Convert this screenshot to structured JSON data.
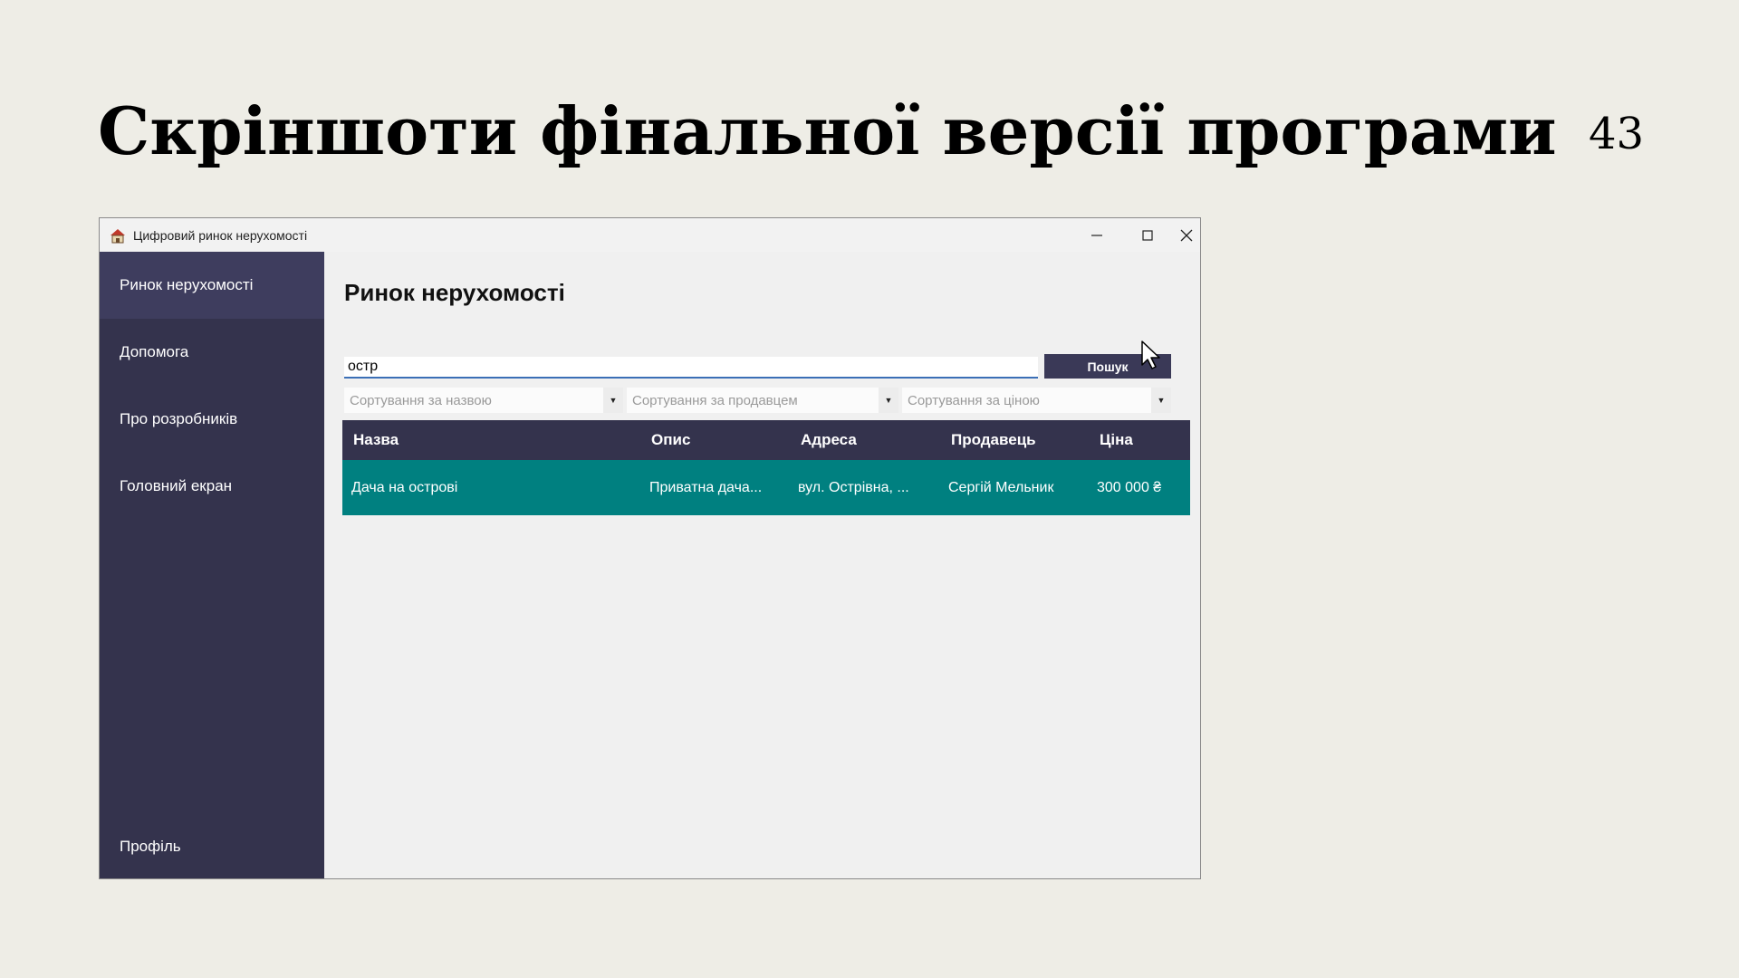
{
  "slide": {
    "title": "Скріншоти фінальної версії програми",
    "page_number": "43"
  },
  "window": {
    "title": "Цифровий ринок нерухомості",
    "icons": [
      "app-house-icon",
      "minimize-icon",
      "maximize-icon",
      "close-icon"
    ]
  },
  "sidebar": {
    "items": [
      {
        "label": "Ринок нерухомості",
        "active": true
      },
      {
        "label": "Допомога"
      },
      {
        "label": "Про розробників"
      },
      {
        "label": "Головний екран"
      }
    ],
    "profile_label": "Профіль"
  },
  "main": {
    "heading": "Ринок нерухомості",
    "search": {
      "value": "остр",
      "button_label": "Пошук"
    },
    "sort": [
      {
        "placeholder": "Сортування за назвою"
      },
      {
        "placeholder": "Сортування за продавцем"
      },
      {
        "placeholder": "Сортування за ціною"
      }
    ],
    "table": {
      "columns": [
        "Назва",
        "Опис",
        "Адреса",
        "Продавець",
        "Ціна"
      ],
      "rows": [
        [
          "Дача на острові",
          "Приватна дача...",
          "вул. Острівна, ...",
          "Сергій Мельник",
          "300 000 ₴"
        ]
      ]
    }
  },
  "colors": {
    "sidebar": "#34334d",
    "sidebar_active": "#3e3d5e",
    "row_selected": "#008080",
    "slide_background": "#eeede6"
  }
}
